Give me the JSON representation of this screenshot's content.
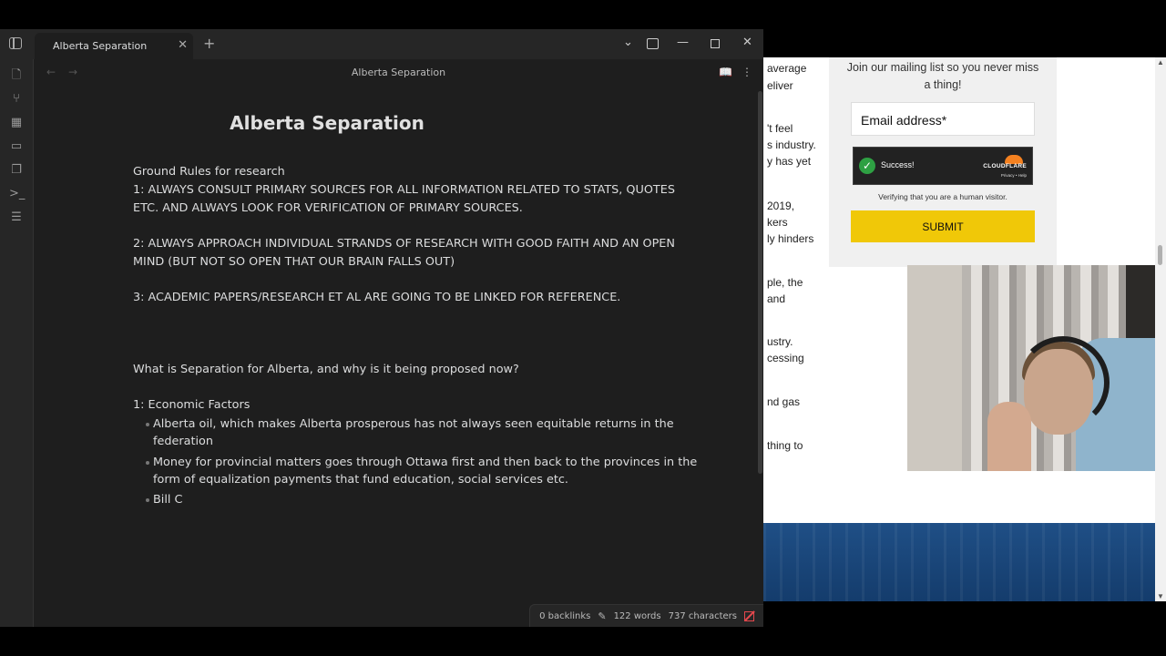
{
  "browser": {
    "article_fragments": [
      "average",
      "eliver",
      "'t feel",
      "s industry.",
      "y has yet",
      "2019,",
      "kers",
      "ly hinders",
      "ple, the",
      "and",
      "ustry.",
      "cessing",
      "nd gas",
      "thing to"
    ],
    "newsletter": {
      "intro": "Join our mailing list so you never miss a thing!",
      "email_placeholder": "Email address*",
      "captcha_status": "Success!",
      "captcha_brand": "CLOUDFLARE",
      "captcha_links": "Privacy • Help",
      "verify_text": "Verifying that you are a human visitor.",
      "submit_label": "SUBMIT"
    }
  },
  "obsidian": {
    "tab_label": "Alberta Separation",
    "view_title": "Alberta Separation",
    "note": {
      "title": "Alberta Separation",
      "lines": [
        "Ground Rules for research",
        "1: ALWAYS CONSULT PRIMARY SOURCES FOR ALL INFORMATION RELATED TO STATS, QUOTES",
        "ETC. AND ALWAYS LOOK FOR VERIFICATION OF PRIMARY SOURCES.",
        "2: ALWAYS APPROACH INDIVIDUAL STRANDS OF RESEARCH WITH GOOD FAITH AND AN OPEN",
        "MIND (BUT NOT SO OPEN THAT OUR BRAIN FALLS OUT)",
        "3: ACADEMIC PAPERS/RESEARCH ET AL ARE GOING TO BE LINKED FOR REFERENCE.",
        "What is Separation for Alberta, and why is it being proposed now?",
        "1: Economic Factors"
      ],
      "bullets": [
        [
          "Alberta oil, which makes Alberta prosperous has not always seen equitable returns in the",
          "federation"
        ],
        [
          "Money for provincial matters goes through Ottawa first and then back to the provinces in the",
          "form of equalization payments that fund education, social services etc."
        ],
        [
          "Bill C"
        ]
      ]
    },
    "status": {
      "backlinks": "0 backlinks",
      "words": "122 words",
      "characters": "737 characters"
    }
  },
  "colors": {
    "submit": "#f0c808",
    "obsidian_bg": "#1e1e1e",
    "sync_error": "#e5484d"
  }
}
